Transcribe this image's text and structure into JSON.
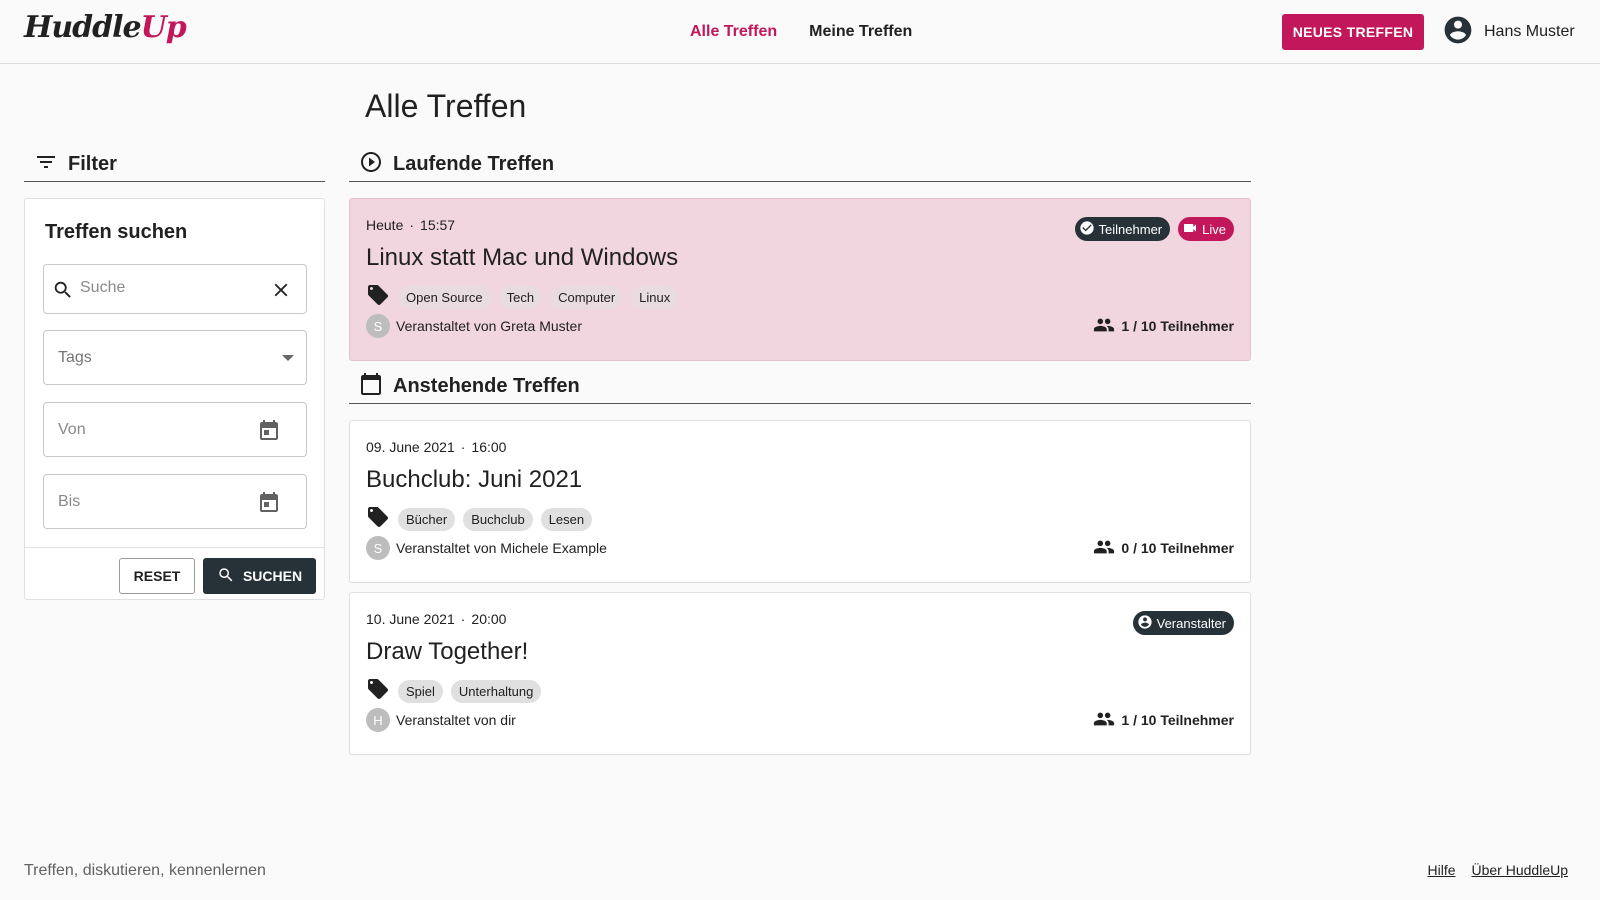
{
  "header": {
    "logo_part1": "Huddle",
    "logo_part2": "Up",
    "nav": [
      {
        "label": "Alle Treffen",
        "active": true
      },
      {
        "label": "Meine Treffen",
        "active": false
      }
    ],
    "new_button": "NEUES TREFFEN",
    "user_name": "Hans Muster",
    "icon": "account-circle-icon"
  },
  "page_title": "Alle Treffen",
  "filter": {
    "heading": "Filter",
    "card_title": "Treffen suchen",
    "search_placeholder": "Suche",
    "tags_placeholder": "Tags",
    "from_placeholder": "Von",
    "to_placeholder": "Bis",
    "reset_label": "RESET",
    "search_label": "SUCHEN"
  },
  "sections": {
    "running": "Laufende Treffen",
    "upcoming": "Anstehende Treffen"
  },
  "meetings": [
    {
      "date": "Heute",
      "time": "15:57",
      "title": "Linux statt Mac und Windows",
      "tags": [
        "Open Source",
        "Tech",
        "Computer",
        "Linux"
      ],
      "organizer_initial": "S",
      "organizer": "Veranstaltet von Greta Muster",
      "participants": "1 / 10 Teilnehmer",
      "badges": [
        {
          "label": "Teilnehmer",
          "style": "dark",
          "icon": "check-circle-icon"
        },
        {
          "label": "Live",
          "style": "pink",
          "icon": "videocam-icon"
        }
      ]
    },
    {
      "date": "09. June 2021",
      "time": "16:00",
      "title": "Buchclub: Juni 2021",
      "tags": [
        "Bücher",
        "Buchclub",
        "Lesen"
      ],
      "organizer_initial": "S",
      "organizer": "Veranstaltet von Michele Example",
      "participants": "0 / 10 Teilnehmer",
      "badges": []
    },
    {
      "date": "10. June 2021",
      "time": "20:00",
      "title": "Draw Together!",
      "tags": [
        "Spiel",
        "Unterhaltung"
      ],
      "organizer_initial": "H",
      "organizer": "Veranstaltet von dir",
      "participants": "1 / 10 Teilnehmer",
      "badges": [
        {
          "label": "Veranstalter",
          "style": "dark",
          "icon": "account-circle-icon"
        }
      ]
    }
  ],
  "footer": {
    "tagline": "Treffen, diskutieren, kennenlernen",
    "links": [
      "Hilfe",
      "Über HuddleUp"
    ]
  },
  "colors": {
    "accent": "#c2185b",
    "dark": "#263238",
    "live_card_bg": "#f2d6df"
  }
}
